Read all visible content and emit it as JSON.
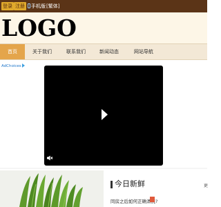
{
  "topbar": {
    "login_label": "登录",
    "register_label": "注册",
    "mobile_label": "手机版",
    "traditional_label": "[繁体]"
  },
  "header": {
    "logo_text": "LOGO"
  },
  "nav": {
    "items": [
      {
        "label": "首页",
        "active": true
      },
      {
        "label": "关于我们",
        "active": false
      },
      {
        "label": "联系我们",
        "active": false
      },
      {
        "label": "新闻动态",
        "active": false
      },
      {
        "label": "网站导航",
        "active": false
      }
    ]
  },
  "ad": {
    "adchoices_label": "AdChoices"
  },
  "video": {
    "play_icon": "play-icon",
    "mute_icon": "mute-icon"
  },
  "section": {
    "title": "今日新鲜",
    "more_label": "更",
    "news": [
      {
        "title": "同房之后如何正确清洗?"
      }
    ]
  },
  "colors": {
    "topbar_bg": "#5b3417",
    "button_bg": "#e0a92c",
    "header_bg": "#fdf6e7",
    "nav_bg": "#f3e8d6",
    "nav_active_bg": "#e4a54b"
  }
}
